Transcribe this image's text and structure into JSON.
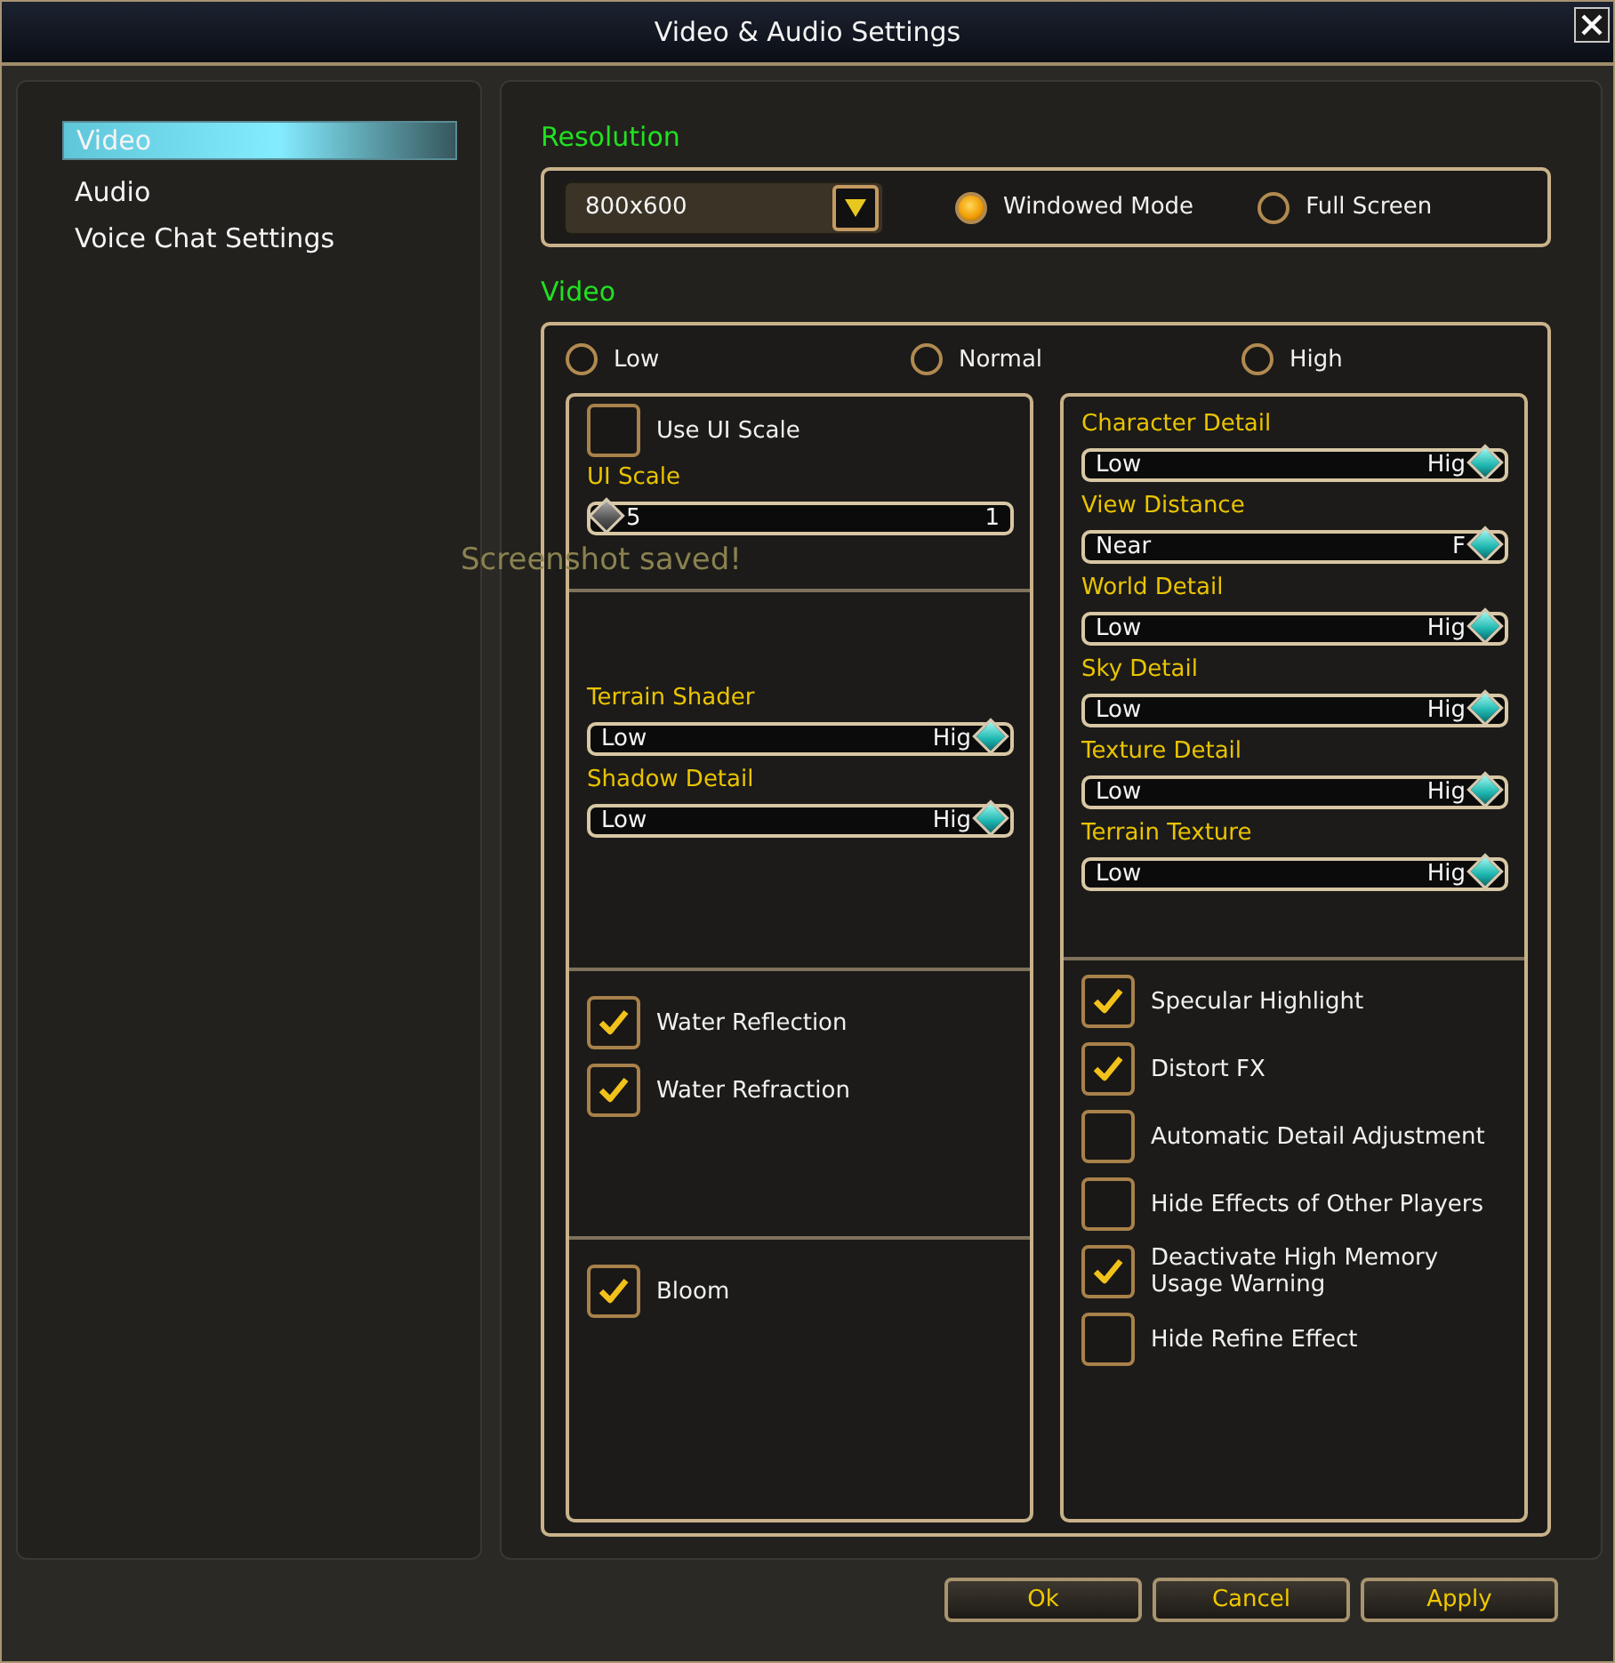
{
  "window": {
    "title": "Video & Audio Settings"
  },
  "sidebar": {
    "items": [
      {
        "label": "Video",
        "selected": true
      },
      {
        "label": "Audio",
        "selected": false
      },
      {
        "label": "Voice Chat Settings",
        "selected": false
      }
    ]
  },
  "resolution": {
    "heading": "Resolution",
    "dropdown": {
      "value": "800x600"
    },
    "modes": [
      {
        "label": "Windowed Mode",
        "selected": true
      },
      {
        "label": "Full Screen",
        "selected": false
      }
    ]
  },
  "video": {
    "heading": "Video",
    "presets": [
      {
        "label": "Low",
        "selected": false
      },
      {
        "label": "Normal",
        "selected": false
      },
      {
        "label": "High",
        "selected": false
      }
    ],
    "left_sections": [
      [
        {
          "kind": "checkbox",
          "label": "Use UI Scale",
          "checked": false
        },
        {
          "kind": "slider",
          "label": "UI Scale",
          "min_label": "5",
          "max_label": "1",
          "level": 0,
          "disabled": true
        }
      ],
      [
        {
          "kind": "slider",
          "label": "Terrain Shader",
          "min_label": "Low",
          "max_label": "Hig",
          "level": 1,
          "disabled": false
        },
        {
          "kind": "slider",
          "label": "Shadow Detail",
          "min_label": "Low",
          "max_label": "Hig",
          "level": 1,
          "disabled": false
        }
      ],
      [
        {
          "kind": "checkbox",
          "label": "Water Reflection",
          "checked": true
        },
        {
          "kind": "checkbox",
          "label": "Water Refraction",
          "checked": true
        }
      ],
      [
        {
          "kind": "checkbox",
          "label": "Bloom",
          "checked": true
        }
      ]
    ],
    "right_sections": [
      [
        {
          "kind": "slider",
          "label": "Character Detail",
          "min_label": "Low",
          "max_label": "Hig",
          "level": 1,
          "disabled": false
        },
        {
          "kind": "slider",
          "label": "View Distance",
          "min_label": "Near",
          "max_label": "F",
          "level": 1,
          "disabled": false
        },
        {
          "kind": "slider",
          "label": "World Detail",
          "min_label": "Low",
          "max_label": "Hig",
          "level": 1,
          "disabled": false
        },
        {
          "kind": "slider",
          "label": "Sky Detail",
          "min_label": "Low",
          "max_label": "Hig",
          "level": 1,
          "disabled": false
        },
        {
          "kind": "slider",
          "label": "Texture Detail",
          "min_label": "Low",
          "max_label": "Hig",
          "level": 1,
          "disabled": false
        },
        {
          "kind": "slider",
          "label": "Terrain Texture",
          "min_label": "Low",
          "max_label": "Hig",
          "level": 1,
          "disabled": false
        }
      ],
      [
        {
          "kind": "checkbox",
          "label": "Specular Highlight",
          "checked": true
        },
        {
          "kind": "checkbox",
          "label": "Distort FX",
          "checked": true
        },
        {
          "kind": "checkbox",
          "label": "Automatic Detail Adjustment",
          "checked": false
        },
        {
          "kind": "checkbox",
          "label": "Hide Effects of Other Players",
          "checked": false
        },
        {
          "kind": "checkbox",
          "label": "Deactivate High Memory Usage Warning",
          "checked": true
        },
        {
          "kind": "checkbox",
          "label": "Hide Refine Effect",
          "checked": false
        }
      ]
    ]
  },
  "overlay_message": "Screenshot saved!",
  "buttons": [
    {
      "label": "Ok"
    },
    {
      "label": "Cancel"
    },
    {
      "label": "Apply"
    }
  ]
}
